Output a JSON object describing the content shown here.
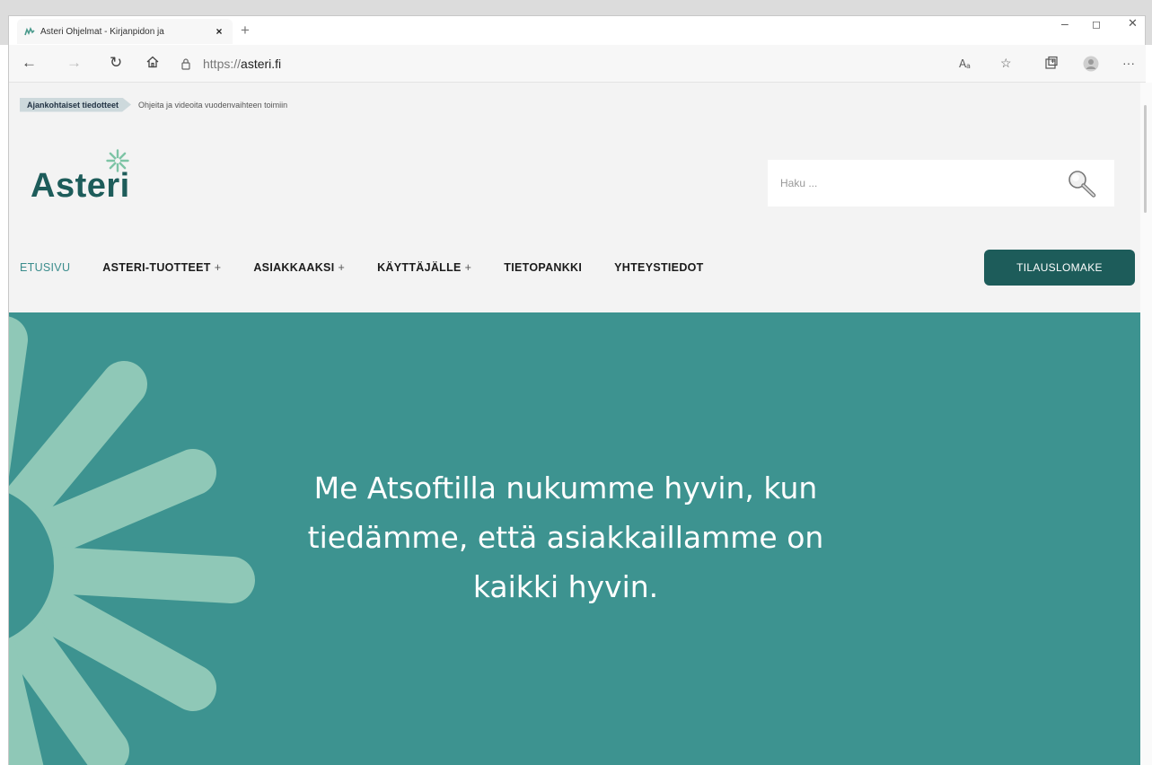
{
  "browser": {
    "tab_title": "Asteri Ohjelmat - Kirjanpidon ja",
    "tab_close": "×",
    "new_tab": "+",
    "url_protocol": "https://",
    "url_host": "asteri.fi",
    "window_controls": {
      "minimize": "–",
      "maximize": "◻",
      "close": "✕"
    }
  },
  "notice": {
    "badge": "Ajankohtaiset tiedotteet",
    "text": "Ohjeita ja videoita vuodenvaihteen toimiin"
  },
  "logo": {
    "text": "Asteri"
  },
  "search": {
    "placeholder": "Haku ..."
  },
  "nav": {
    "items": [
      {
        "label": "ETUSIVU",
        "active": true,
        "submenu": false
      },
      {
        "label": "ASTERI-TUOTTEET",
        "active": false,
        "submenu": true
      },
      {
        "label": "ASIAKKAAKSI",
        "active": false,
        "submenu": true
      },
      {
        "label": "KÄYTTÄJÄLLE",
        "active": false,
        "submenu": true
      },
      {
        "label": "TIETOPANKKI",
        "active": false,
        "submenu": false
      },
      {
        "label": "YHTEYSTIEDOT",
        "active": false,
        "submenu": false
      }
    ],
    "submenu_marker": "+",
    "order_button": "TILAUSLOMAKE"
  },
  "hero": {
    "headline": "Me Atsoftilla nukumme hyvin, kun tiedämme, että asiakkaillamme on kaikki hyvin."
  },
  "colors": {
    "brand_dark": "#1d5c5a",
    "brand_teal": "#3d9390",
    "active_nav": "#3a8c8c",
    "flower_light": "#8fc8b7",
    "logo_star": "#7dc4a5"
  },
  "icons": [
    "back-icon",
    "forward-icon",
    "refresh-icon",
    "home-icon",
    "lock-icon",
    "read-aloud-icon",
    "favorites-icon",
    "collections-icon",
    "profile-icon",
    "more-icon",
    "search-icon",
    "asteri-star-icon"
  ]
}
